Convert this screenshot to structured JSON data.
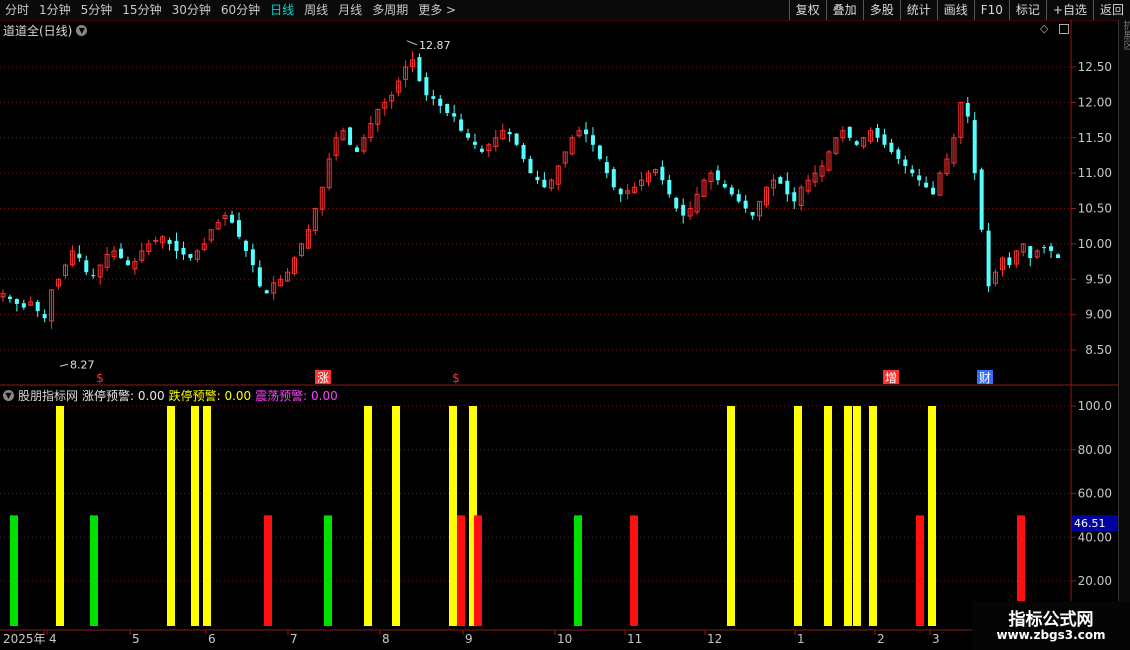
{
  "toolbar": {
    "periods": [
      "分时",
      "1分钟",
      "5分钟",
      "15分钟",
      "30分钟",
      "60分钟",
      "日线",
      "周线",
      "月线",
      "多周期",
      "更多 >"
    ],
    "active_period": "日线",
    "right_buttons": [
      "复权",
      "叠加",
      "多股",
      "统计",
      "画线",
      "F10",
      "标记",
      "+自选",
      "返回"
    ]
  },
  "main_chart": {
    "title": "道道全(日线)",
    "high_label": "12.87",
    "low_label": "8.27",
    "y_ticks": [
      "12.50",
      "12.00",
      "11.50",
      "11.00",
      "10.50",
      "10.00",
      "9.50",
      "9.00",
      "8.50"
    ],
    "markers": [
      "$",
      "涨",
      "$",
      "增",
      "财"
    ],
    "up_color": "#ff3030",
    "down_color": "#54ffff"
  },
  "indicator": {
    "name": "股朋指标网",
    "items": [
      {
        "label": "涨停预警: 0.00",
        "color": "#e8e8e8"
      },
      {
        "label": "跌停预警: 0.00",
        "color": "#ffff00"
      },
      {
        "label": "震荡预警: 0.00",
        "color": "#ff40ff"
      }
    ],
    "y_ticks": [
      "100.0",
      "80.00",
      "60.00",
      "40.00",
      "20.00"
    ],
    "current_value": "46.51"
  },
  "x_axis": {
    "labels": [
      "2025年",
      "4",
      "5",
      "6",
      "7",
      "8",
      "9",
      "10",
      "11",
      "12",
      "1",
      "2",
      "3"
    ]
  },
  "sidebar_text": "扩展区",
  "watermark": {
    "line1": "指标公式网",
    "line2": "www.zbgs3.com"
  },
  "chart_data": {
    "type": "candlestick",
    "price_range": [
      8.27,
      12.87
    ],
    "closes": [
      9.3,
      9.22,
      9.15,
      9.1,
      9.18,
      9.05,
      8.95,
      9.35,
      9.5,
      9.7,
      9.9,
      9.8,
      9.6,
      9.55,
      9.7,
      9.85,
      9.9,
      9.8,
      9.7,
      9.75,
      9.9,
      10.0,
      10.05,
      10.1,
      10.0,
      9.9,
      9.85,
      9.8,
      9.9,
      10.0,
      10.2,
      10.3,
      10.4,
      10.3,
      10.1,
      9.9,
      9.7,
      9.4,
      9.3,
      9.45,
      9.5,
      9.6,
      9.8,
      10.0,
      10.2,
      10.5,
      10.8,
      11.2,
      11.5,
      11.6,
      11.4,
      11.3,
      11.5,
      11.7,
      11.9,
      12.0,
      12.1,
      12.3,
      12.5,
      12.6,
      12.3,
      12.1,
      12.05,
      11.95,
      11.85,
      11.8,
      11.6,
      11.5,
      11.4,
      11.3,
      11.4,
      11.5,
      11.6,
      11.55,
      11.4,
      11.2,
      11.0,
      10.9,
      10.8,
      10.9,
      11.1,
      11.3,
      11.5,
      11.6,
      11.55,
      11.4,
      11.2,
      11.0,
      10.8,
      10.7,
      10.75,
      10.8,
      10.9,
      11.0,
      11.05,
      10.9,
      10.7,
      10.5,
      10.4,
      10.5,
      10.7,
      10.9,
      11.0,
      10.9,
      10.8,
      10.7,
      10.6,
      10.5,
      10.4,
      10.6,
      10.8,
      10.9,
      10.85,
      10.7,
      10.6,
      10.8,
      10.9,
      11.0,
      11.1,
      11.3,
      11.5,
      11.6,
      11.5,
      11.4,
      11.5,
      11.6,
      11.5,
      11.4,
      11.3,
      11.2,
      11.1,
      11.0,
      10.9,
      10.8,
      10.7,
      11.0,
      11.2,
      11.5,
      12.0,
      11.8,
      11.0,
      10.2,
      9.4,
      9.6,
      9.8,
      9.7,
      9.9,
      10.0,
      9.8,
      9.9,
      9.95,
      9.9,
      9.8
    ],
    "indicator_bars": [
      {
        "x": 14,
        "value": 50,
        "color": "green"
      },
      {
        "x": 60,
        "value": 100,
        "color": "yellow"
      },
      {
        "x": 94,
        "value": 50,
        "color": "green"
      },
      {
        "x": 171,
        "value": 100,
        "color": "yellow"
      },
      {
        "x": 195,
        "value": 100,
        "color": "yellow"
      },
      {
        "x": 207,
        "value": 100,
        "color": "yellow"
      },
      {
        "x": 268,
        "value": 50,
        "color": "red"
      },
      {
        "x": 328,
        "value": 50,
        "color": "green"
      },
      {
        "x": 368,
        "value": 100,
        "color": "yellow"
      },
      {
        "x": 396,
        "value": 100,
        "color": "yellow"
      },
      {
        "x": 453,
        "value": 100,
        "color": "yellow"
      },
      {
        "x": 461,
        "value": 50,
        "color": "red"
      },
      {
        "x": 473,
        "value": 100,
        "color": "yellow"
      },
      {
        "x": 478,
        "value": 50,
        "color": "red"
      },
      {
        "x": 578,
        "value": 50,
        "color": "green"
      },
      {
        "x": 634,
        "value": 50,
        "color": "red"
      },
      {
        "x": 731,
        "value": 100,
        "color": "yellow"
      },
      {
        "x": 798,
        "value": 100,
        "color": "yellow"
      },
      {
        "x": 828,
        "value": 100,
        "color": "yellow"
      },
      {
        "x": 848,
        "value": 100,
        "color": "yellow"
      },
      {
        "x": 857,
        "value": 100,
        "color": "yellow"
      },
      {
        "x": 873,
        "value": 100,
        "color": "yellow"
      },
      {
        "x": 920,
        "value": 50,
        "color": "red"
      },
      {
        "x": 932,
        "value": 100,
        "color": "yellow"
      },
      {
        "x": 1021,
        "value": 50,
        "color": "red"
      }
    ]
  }
}
